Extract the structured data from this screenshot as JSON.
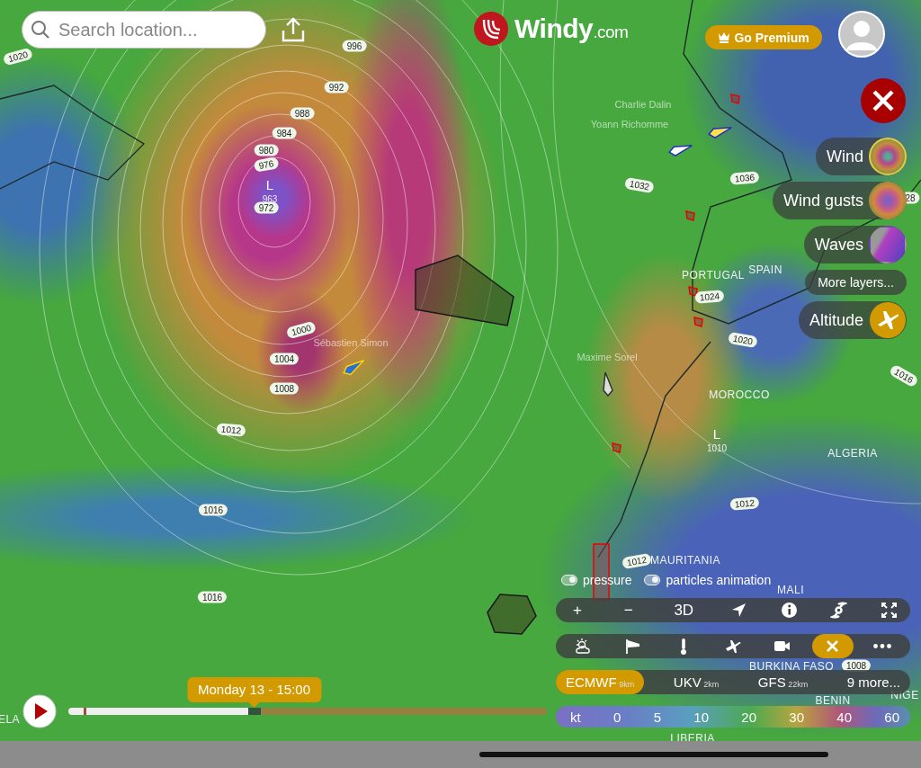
{
  "search": {
    "placeholder": "Search location..."
  },
  "logo": {
    "name": "Windy",
    "suffix": ".com"
  },
  "premium_button": {
    "label": "Go Premium"
  },
  "layers": [
    {
      "kind": "thumbnail",
      "label": "Wind",
      "selected": true
    },
    {
      "kind": "thumbnail",
      "label": "Wind gusts",
      "selected": false
    },
    {
      "kind": "thumbnail",
      "label": "Waves",
      "selected": false
    },
    {
      "kind": "text",
      "label": "More layers..."
    },
    {
      "kind": "icon",
      "label": "Altitude"
    }
  ],
  "toggles": [
    {
      "label": "pressure",
      "on": true
    },
    {
      "label": "particles animation",
      "on": true
    }
  ],
  "map_tools": [
    {
      "kind": "text",
      "label": "+"
    },
    {
      "kind": "text",
      "label": "−"
    },
    {
      "kind": "text",
      "label": "3D"
    },
    {
      "kind": "locate"
    },
    {
      "kind": "info"
    },
    {
      "kind": "hurricane"
    },
    {
      "kind": "fullscreen"
    }
  ],
  "categories": [
    {
      "kind": "weather",
      "selected": false
    },
    {
      "kind": "wind",
      "selected": false
    },
    {
      "kind": "temperature",
      "selected": false
    },
    {
      "kind": "plane",
      "selected": false
    },
    {
      "kind": "camera",
      "selected": false
    },
    {
      "kind": "close",
      "selected": true
    },
    {
      "kind": "more",
      "selected": false
    }
  ],
  "models": [
    {
      "name": "ECMWF",
      "resolution": "9km",
      "selected": true
    },
    {
      "name": "UKV",
      "resolution": "2km",
      "selected": false
    },
    {
      "name": "GFS",
      "resolution": "22km",
      "selected": false
    },
    {
      "name": "9 more...",
      "selected": false
    }
  ],
  "legend": {
    "unit": "kt",
    "values": [
      "0",
      "5",
      "10",
      "20",
      "30",
      "40",
      "60"
    ]
  },
  "timeline": {
    "label": "Monday 13 - 15:00",
    "level": 0.375
  },
  "map": {
    "isobars": [
      "1020",
      "996",
      "992",
      "988",
      "984",
      "980",
      "976",
      "972",
      "1000",
      "1004",
      "1008",
      "1012",
      "1016",
      "1016",
      "1032",
      "1036",
      "1024",
      "1020",
      "1016",
      "1012",
      "1012",
      "1008",
      "28"
    ],
    "lows": [
      {
        "letter": "L",
        "pressure": "963"
      },
      {
        "letter": "L",
        "pressure": "1010"
      }
    ],
    "places": [
      "PORTUGAL",
      "SPAIN",
      "MOROCCO",
      "ALGERIA",
      "MAURITANIA",
      "MALI",
      "BURKINA FASO",
      "BENIN",
      "NIGE",
      "LIBERIA",
      "ELA"
    ],
    "sailors": [
      "Sébastien Simon",
      "Charlie Dalin",
      "Yoann Richomme",
      "Maxime Sorel"
    ]
  }
}
